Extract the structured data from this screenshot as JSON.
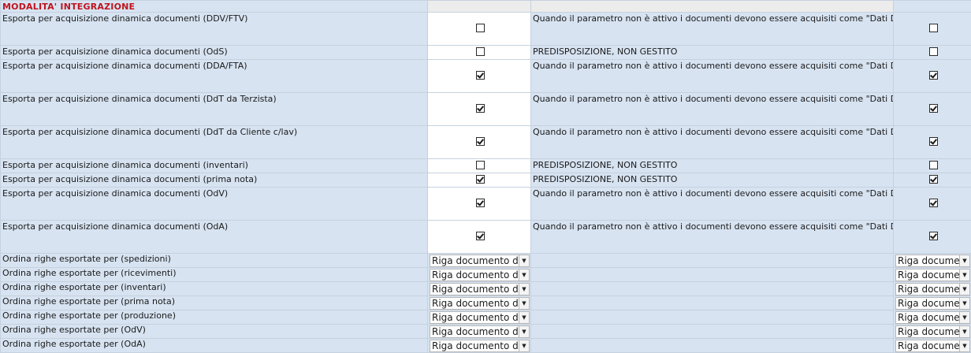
{
  "section_title": "MODALITA' INTEGRAZIONE",
  "checkbox_rows": [
    {
      "label": "Esporta per acquisizione dinamica documenti (DDV/FTV)",
      "checked": false,
      "note": "Quando il parametro non è attivo i documenti devono essere acquisiti come \"Dati Da Terminali Portatili\"",
      "right_checked": false,
      "tall": true
    },
    {
      "label": "Esporta per acquisizione dinamica documenti (OdS)",
      "checked": false,
      "note": "PREDISPOSIZIONE, NON GESTITO",
      "right_checked": false,
      "tall": false
    },
    {
      "label": "Esporta per acquisizione dinamica documenti (DDA/FTA)",
      "checked": true,
      "note": "Quando il parametro non è attivo i documenti devono essere acquisiti come \"Dati Da Terminali Portatili\"",
      "right_checked": true,
      "tall": true
    },
    {
      "label": "Esporta per acquisizione dinamica documenti (DdT da Terzista)",
      "checked": true,
      "note": "Quando il parametro non è attivo i documenti devono essere acquisiti come \"Dati Da Terminali Portatili\"",
      "right_checked": true,
      "tall": true
    },
    {
      "label": "Esporta per acquisizione dinamica documenti (DdT da Cliente c/lav)",
      "checked": true,
      "note": "Quando il parametro non è attivo i documenti devono essere acquisiti come \"Dati Da Terminali Portatili\"",
      "right_checked": true,
      "tall": true
    },
    {
      "label": "Esporta per acquisizione dinamica documenti (inventari)",
      "checked": false,
      "note": "PREDISPOSIZIONE, NON GESTITO",
      "right_checked": false,
      "tall": false
    },
    {
      "label": "Esporta per acquisizione dinamica documenti (prima nota)",
      "checked": true,
      "note": "PREDISPOSIZIONE, NON GESTITO",
      "right_checked": true,
      "tall": false
    },
    {
      "label": "Esporta per acquisizione dinamica documenti (OdV)",
      "checked": true,
      "note": "Quando il parametro non è attivo i documenti devono essere acquisiti come \"Dati Da Terminali Portatili\"",
      "right_checked": true,
      "tall": true
    },
    {
      "label": "Esporta per acquisizione dinamica documenti (OdA)",
      "checked": true,
      "note": "Quando il parametro non è attivo i documenti devono essere acquisiti come \"Dati Da Terminali Portatili\"",
      "right_checked": true,
      "tall": true
    }
  ],
  "select_rows": [
    {
      "label": "Ordina righe esportate per (spedizioni)",
      "value": "Riga documento de",
      "right_value": "Riga documen"
    },
    {
      "label": "Ordina righe esportate per (ricevimenti)",
      "value": "Riga documento de",
      "right_value": "Riga documen"
    },
    {
      "label": "Ordina righe esportate per (inventari)",
      "value": "Riga documento de",
      "right_value": "Riga documen"
    },
    {
      "label": "Ordina righe esportate per (prima nota)",
      "value": "Riga documento de",
      "right_value": "Riga documen"
    },
    {
      "label": "Ordina righe esportate per (produzione)",
      "value": "Riga documento de",
      "right_value": "Riga documen"
    },
    {
      "label": "Ordina righe esportate per (OdV)",
      "value": "Riga documento de",
      "right_value": "Riga documen"
    },
    {
      "label": "Ordina righe esportate per (OdA)",
      "value": "Riga documento de",
      "right_value": "Riga documen"
    }
  ],
  "icons": {
    "dropdown": "chevron-down-icon"
  }
}
